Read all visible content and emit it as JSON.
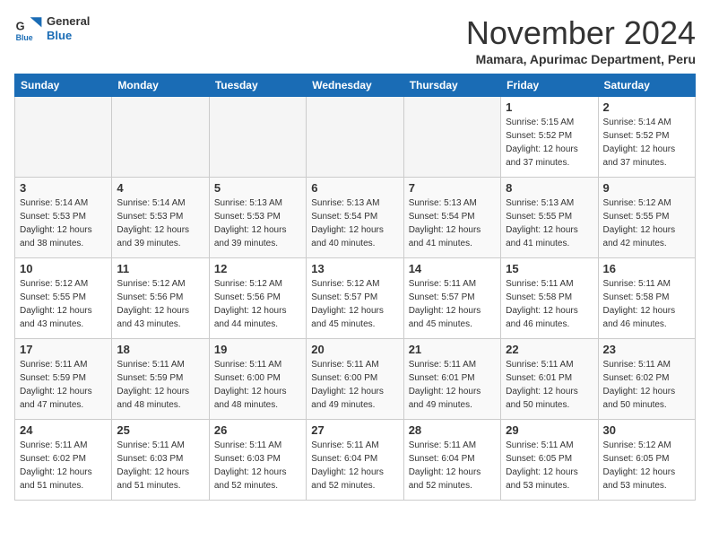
{
  "logo": {
    "line1": "General",
    "line2": "Blue"
  },
  "title": "November 2024",
  "subtitle": "Mamara, Apurimac Department, Peru",
  "days_of_week": [
    "Sunday",
    "Monday",
    "Tuesday",
    "Wednesday",
    "Thursday",
    "Friday",
    "Saturday"
  ],
  "weeks": [
    [
      {
        "day": "",
        "info": ""
      },
      {
        "day": "",
        "info": ""
      },
      {
        "day": "",
        "info": ""
      },
      {
        "day": "",
        "info": ""
      },
      {
        "day": "",
        "info": ""
      },
      {
        "day": "1",
        "info": "Sunrise: 5:15 AM\nSunset: 5:52 PM\nDaylight: 12 hours\nand 37 minutes."
      },
      {
        "day": "2",
        "info": "Sunrise: 5:14 AM\nSunset: 5:52 PM\nDaylight: 12 hours\nand 37 minutes."
      }
    ],
    [
      {
        "day": "3",
        "info": "Sunrise: 5:14 AM\nSunset: 5:53 PM\nDaylight: 12 hours\nand 38 minutes."
      },
      {
        "day": "4",
        "info": "Sunrise: 5:14 AM\nSunset: 5:53 PM\nDaylight: 12 hours\nand 39 minutes."
      },
      {
        "day": "5",
        "info": "Sunrise: 5:13 AM\nSunset: 5:53 PM\nDaylight: 12 hours\nand 39 minutes."
      },
      {
        "day": "6",
        "info": "Sunrise: 5:13 AM\nSunset: 5:54 PM\nDaylight: 12 hours\nand 40 minutes."
      },
      {
        "day": "7",
        "info": "Sunrise: 5:13 AM\nSunset: 5:54 PM\nDaylight: 12 hours\nand 41 minutes."
      },
      {
        "day": "8",
        "info": "Sunrise: 5:13 AM\nSunset: 5:55 PM\nDaylight: 12 hours\nand 41 minutes."
      },
      {
        "day": "9",
        "info": "Sunrise: 5:12 AM\nSunset: 5:55 PM\nDaylight: 12 hours\nand 42 minutes."
      }
    ],
    [
      {
        "day": "10",
        "info": "Sunrise: 5:12 AM\nSunset: 5:55 PM\nDaylight: 12 hours\nand 43 minutes."
      },
      {
        "day": "11",
        "info": "Sunrise: 5:12 AM\nSunset: 5:56 PM\nDaylight: 12 hours\nand 43 minutes."
      },
      {
        "day": "12",
        "info": "Sunrise: 5:12 AM\nSunset: 5:56 PM\nDaylight: 12 hours\nand 44 minutes."
      },
      {
        "day": "13",
        "info": "Sunrise: 5:12 AM\nSunset: 5:57 PM\nDaylight: 12 hours\nand 45 minutes."
      },
      {
        "day": "14",
        "info": "Sunrise: 5:11 AM\nSunset: 5:57 PM\nDaylight: 12 hours\nand 45 minutes."
      },
      {
        "day": "15",
        "info": "Sunrise: 5:11 AM\nSunset: 5:58 PM\nDaylight: 12 hours\nand 46 minutes."
      },
      {
        "day": "16",
        "info": "Sunrise: 5:11 AM\nSunset: 5:58 PM\nDaylight: 12 hours\nand 46 minutes."
      }
    ],
    [
      {
        "day": "17",
        "info": "Sunrise: 5:11 AM\nSunset: 5:59 PM\nDaylight: 12 hours\nand 47 minutes."
      },
      {
        "day": "18",
        "info": "Sunrise: 5:11 AM\nSunset: 5:59 PM\nDaylight: 12 hours\nand 48 minutes."
      },
      {
        "day": "19",
        "info": "Sunrise: 5:11 AM\nSunset: 6:00 PM\nDaylight: 12 hours\nand 48 minutes."
      },
      {
        "day": "20",
        "info": "Sunrise: 5:11 AM\nSunset: 6:00 PM\nDaylight: 12 hours\nand 49 minutes."
      },
      {
        "day": "21",
        "info": "Sunrise: 5:11 AM\nSunset: 6:01 PM\nDaylight: 12 hours\nand 49 minutes."
      },
      {
        "day": "22",
        "info": "Sunrise: 5:11 AM\nSunset: 6:01 PM\nDaylight: 12 hours\nand 50 minutes."
      },
      {
        "day": "23",
        "info": "Sunrise: 5:11 AM\nSunset: 6:02 PM\nDaylight: 12 hours\nand 50 minutes."
      }
    ],
    [
      {
        "day": "24",
        "info": "Sunrise: 5:11 AM\nSunset: 6:02 PM\nDaylight: 12 hours\nand 51 minutes."
      },
      {
        "day": "25",
        "info": "Sunrise: 5:11 AM\nSunset: 6:03 PM\nDaylight: 12 hours\nand 51 minutes."
      },
      {
        "day": "26",
        "info": "Sunrise: 5:11 AM\nSunset: 6:03 PM\nDaylight: 12 hours\nand 52 minutes."
      },
      {
        "day": "27",
        "info": "Sunrise: 5:11 AM\nSunset: 6:04 PM\nDaylight: 12 hours\nand 52 minutes."
      },
      {
        "day": "28",
        "info": "Sunrise: 5:11 AM\nSunset: 6:04 PM\nDaylight: 12 hours\nand 52 minutes."
      },
      {
        "day": "29",
        "info": "Sunrise: 5:11 AM\nSunset: 6:05 PM\nDaylight: 12 hours\nand 53 minutes."
      },
      {
        "day": "30",
        "info": "Sunrise: 5:12 AM\nSunset: 6:05 PM\nDaylight: 12 hours\nand 53 minutes."
      }
    ]
  ]
}
